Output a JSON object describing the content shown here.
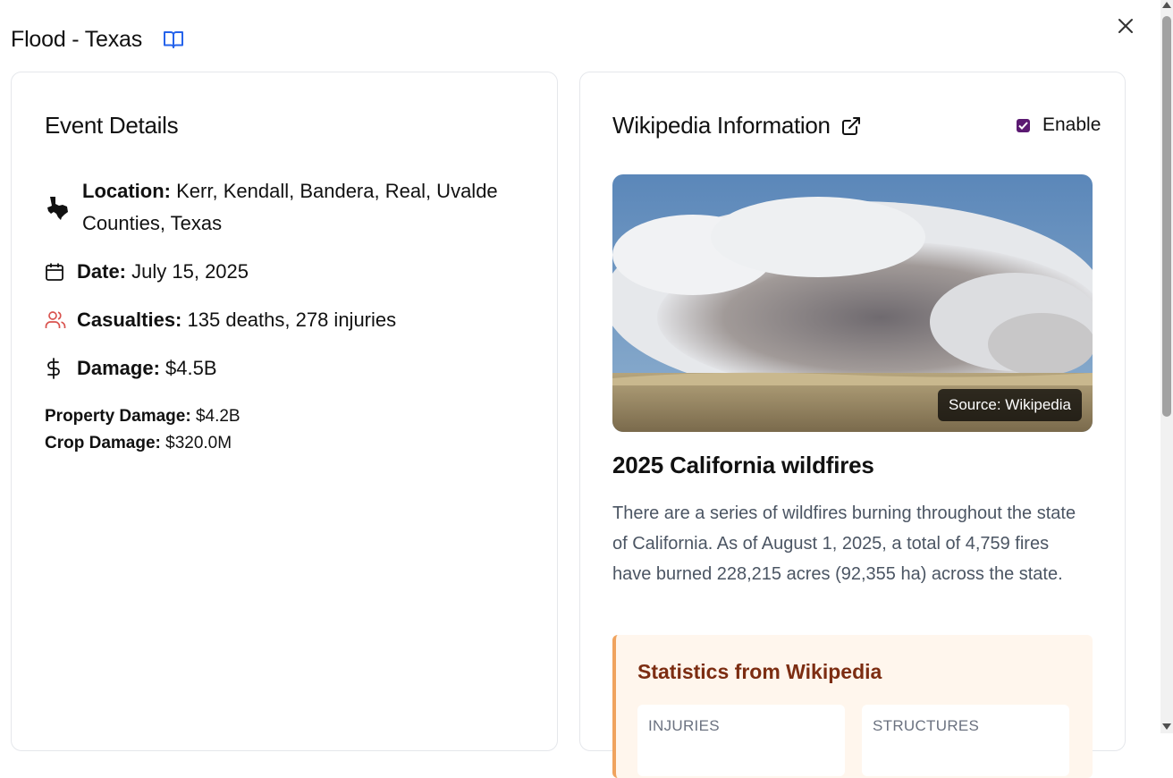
{
  "modal": {
    "title": "Flood - Texas",
    "book_icon": "book-open-icon",
    "close_icon": "close-icon"
  },
  "event_details": {
    "heading": "Event Details",
    "location": {
      "icon": "texas-state-icon",
      "label": "Location:",
      "value": "Kerr, Kendall, Bandera, Real, Uvalde Counties, Texas"
    },
    "date": {
      "icon": "calendar-icon",
      "label": "Date:",
      "value": "July 15, 2025"
    },
    "casualties": {
      "icon": "users-icon",
      "label": "Casualties:",
      "value": "135 deaths, 278 injuries",
      "icon_color": "#d9534f"
    },
    "damage": {
      "icon": "dollar-icon",
      "label": "Damage:",
      "value": "$4.5B"
    },
    "property_damage": {
      "label": "Property Damage:",
      "value": "$4.2B"
    },
    "crop_damage": {
      "label": "Crop Damage:",
      "value": "$320.0M"
    }
  },
  "wikipedia": {
    "heading": "Wikipedia Information",
    "external_icon": "external-link-icon",
    "enable_label": "Enable",
    "enable_checked": true,
    "image_badge": "Source: Wikipedia",
    "article_title": "2025 California wildfires",
    "summary": "There are a series of wildfires burning throughout the state of California. As of August 1, 2025, a total of 4,759 fires have burned 228,215 acres (92,355 ha) across the state.",
    "stats": {
      "title": "Statistics from Wikipedia",
      "items": [
        {
          "label": "INJURIES"
        },
        {
          "label": "STRUCTURES"
        }
      ]
    }
  },
  "colors": {
    "accent_purple": "#5b1a72",
    "link_blue": "#2563eb",
    "stats_bg": "#fff6ed",
    "stats_border": "#f0a35e",
    "stats_title": "#7c2d12"
  }
}
